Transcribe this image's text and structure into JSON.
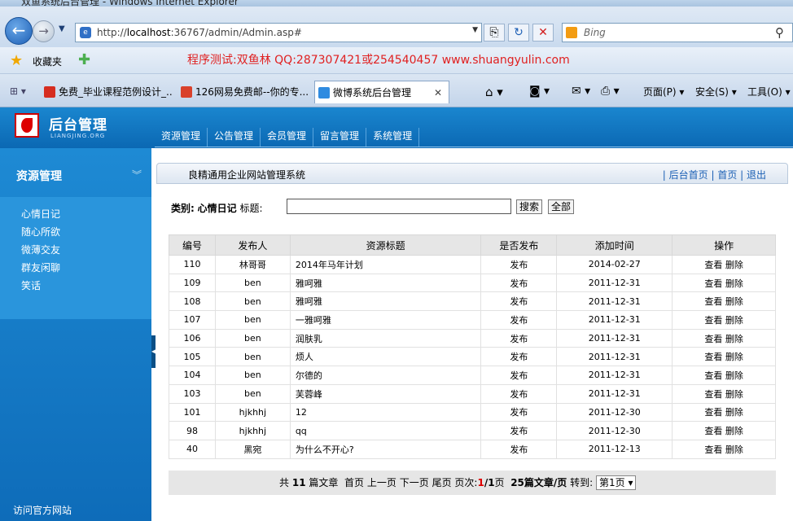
{
  "browser": {
    "window_title": "双鱼系统后台管理 - Windows Internet Explorer",
    "url_prefix": "http://",
    "url_host": "localhost",
    "url_rest": ":36767/admin/Admin.asp#",
    "search_provider": "Bing",
    "favorites_label": "收藏夹",
    "banner": "程序测试:双鱼林 QQ:287307421或254540457 www.shuangyulin.com",
    "tabs": [
      {
        "label": "免费_毕业课程范例设计_...",
        "icon_color": "#d62d20"
      },
      {
        "label": "126网易免费邮--你的专...",
        "icon_color": "#d9412b"
      },
      {
        "label": "微博系统后台管理",
        "icon_color": "#2f8be0"
      }
    ],
    "commands": [
      "页面(P) ▾",
      "安全(S) ▾",
      "工具(O) ▾"
    ]
  },
  "app": {
    "logo_title": "后台管理",
    "logo_sub": "LIANGJING.ORG",
    "nav": [
      "资源管理",
      "公告管理",
      "会员管理",
      "留言管理",
      "系统管理"
    ],
    "sidebar": {
      "heading": "资源管理",
      "items": [
        "心情日记",
        "随心所欲",
        "微薄交友",
        "群友闲聊",
        "笑话"
      ],
      "footer": "访问官方网站"
    },
    "breadcrumb": {
      "title": "良精通用企业网站管理系统",
      "links": "| 后台首页 | 首页 | 退出"
    },
    "filter": {
      "category_label": "类别:",
      "category_value": "心情日记",
      "title_label": "标题:",
      "search_value": "",
      "search_button": "搜索",
      "all_button": "全部"
    },
    "table": {
      "headers": [
        "编号",
        "发布人",
        "资源标题",
        "是否发布",
        "添加时间",
        "操作"
      ],
      "view_label": "查看",
      "delete_label": "删除",
      "rows": [
        {
          "id": "110",
          "author": "林哥哥",
          "title": "2014年马年计划",
          "status": "发布",
          "date": "2014-02-27"
        },
        {
          "id": "109",
          "author": "ben",
          "title": "雅呵雅",
          "status": "发布",
          "date": "2011-12-31"
        },
        {
          "id": "108",
          "author": "ben",
          "title": "雅呵雅",
          "status": "发布",
          "date": "2011-12-31"
        },
        {
          "id": "107",
          "author": "ben",
          "title": "一雅呵雅",
          "status": "发布",
          "date": "2011-12-31"
        },
        {
          "id": "106",
          "author": "ben",
          "title": "润肤乳",
          "status": "发布",
          "date": "2011-12-31"
        },
        {
          "id": "105",
          "author": "ben",
          "title": "烦人",
          "status": "发布",
          "date": "2011-12-31"
        },
        {
          "id": "104",
          "author": "ben",
          "title": "尔德的",
          "status": "发布",
          "date": "2011-12-31"
        },
        {
          "id": "103",
          "author": "ben",
          "title": "芙蓉峰",
          "status": "发布",
          "date": "2011-12-31"
        },
        {
          "id": "101",
          "author": "hjkhhj",
          "title": "12",
          "status": "发布",
          "date": "2011-12-30"
        },
        {
          "id": "98",
          "author": "hjkhhj",
          "title": "qq",
          "status": "发布",
          "date": "2011-12-30"
        },
        {
          "id": "40",
          "author": "黑宛",
          "title": "为什么不开心?",
          "status": "发布",
          "date": "2011-12-13"
        }
      ]
    },
    "pager": {
      "total_prefix": "共",
      "total": "11",
      "total_suffix": "篇文章",
      "first": "首页",
      "prev": "上一页",
      "next": "下一页",
      "last": "尾页",
      "page_label": "页次:",
      "current_page": "1",
      "total_pages": "/1",
      "page_unit": "页",
      "per_page": "25篇文章/页",
      "goto_label": "转到:",
      "goto_value": "第1页 ▾"
    }
  }
}
